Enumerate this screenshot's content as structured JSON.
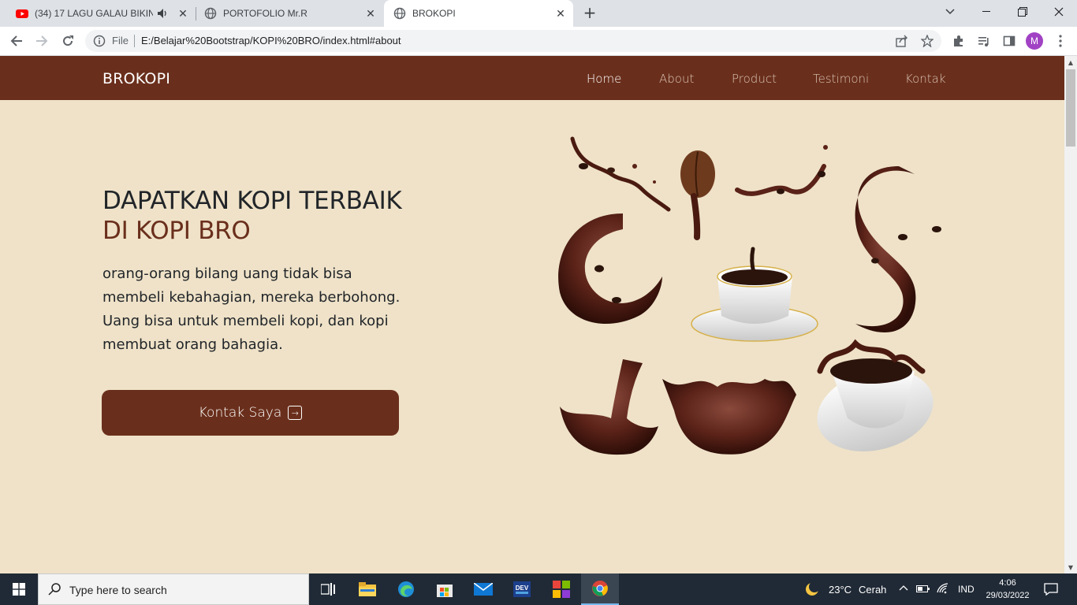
{
  "browser": {
    "tabs": [
      {
        "title": "(34) 17 LAGU GALAU BIKIN B...",
        "favicon": "youtube-icon",
        "audio": true
      },
      {
        "title": "PORTOFOLIO Mr.R",
        "favicon": "globe-icon"
      },
      {
        "title": "BROKOPI",
        "favicon": "globe-icon",
        "active": true
      }
    ],
    "omnibox": {
      "scheme_label": "File",
      "url": "E:/Belajar%20Bootstrap/KOPI%20BRO/index.html#about"
    },
    "profile_initial": "M"
  },
  "page": {
    "brand": "BROKOPI",
    "nav": [
      "Home",
      "About",
      "Product",
      "Testimoni",
      "Kontak"
    ],
    "hero": {
      "title_line1": "DAPATKAN KOPI TERBAIK",
      "title_line2": "DI KOPI BRO",
      "paragraph": "orang-orang bilang uang tidak bisa membeli kebahagian, mereka berbohong. Uang bisa untuk membeli kopi, dan kopi membuat orang bahagia.",
      "cta_label": "Kontak Saya"
    },
    "colors": {
      "primary": "#6a2f1c",
      "background": "#efe2c8"
    }
  },
  "taskbar": {
    "search_placeholder": "Type here to search",
    "weather_temp": "23°C",
    "weather_desc": "Cerah",
    "language": "IND",
    "time": "4:06",
    "date": "29/03/2022"
  }
}
